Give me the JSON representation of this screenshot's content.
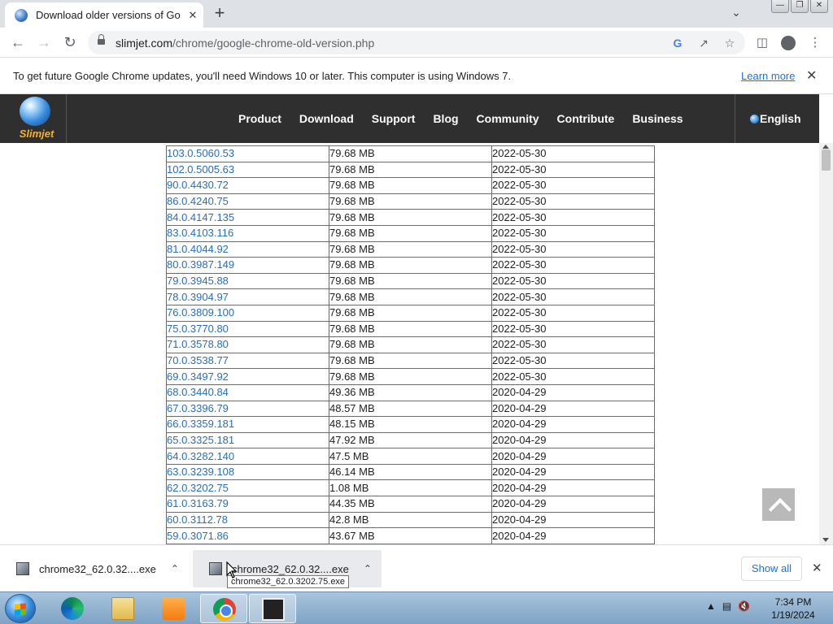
{
  "browser": {
    "tab_title": "Download older versions of Goog",
    "tab_close": "✕",
    "new_tab": "+",
    "tab_search": "⌄",
    "window_buttons": [
      "—",
      "❐",
      "✕"
    ],
    "url_domain": "slimjet.com",
    "url_path": "/chrome/google-chrome-old-version.php"
  },
  "infobar": {
    "message": "To get future Google Chrome updates, you'll need Windows 10 or later. This computer is using Windows 7.",
    "learn_more": "Learn more",
    "close": "✕"
  },
  "site": {
    "logo_text": "Slimjet",
    "nav": [
      "Product",
      "Download",
      "Support",
      "Blog",
      "Community",
      "Contribute",
      "Business"
    ],
    "language": "English"
  },
  "versions": [
    {
      "version": "103.0.5060.53",
      "size": "79.68 MB",
      "date": "2022-05-30"
    },
    {
      "version": "102.0.5005.63",
      "size": "79.68 MB",
      "date": "2022-05-30"
    },
    {
      "version": "90.0.4430.72",
      "size": "79.68 MB",
      "date": "2022-05-30"
    },
    {
      "version": "86.0.4240.75",
      "size": "79.68 MB",
      "date": "2022-05-30"
    },
    {
      "version": "84.0.4147.135",
      "size": "79.68 MB",
      "date": "2022-05-30"
    },
    {
      "version": "83.0.4103.116",
      "size": "79.68 MB",
      "date": "2022-05-30"
    },
    {
      "version": "81.0.4044.92",
      "size": "79.68 MB",
      "date": "2022-05-30"
    },
    {
      "version": "80.0.3987.149",
      "size": "79.68 MB",
      "date": "2022-05-30"
    },
    {
      "version": "79.0.3945.88",
      "size": "79.68 MB",
      "date": "2022-05-30"
    },
    {
      "version": "78.0.3904.97",
      "size": "79.68 MB",
      "date": "2022-05-30"
    },
    {
      "version": "76.0.3809.100",
      "size": "79.68 MB",
      "date": "2022-05-30"
    },
    {
      "version": "75.0.3770.80",
      "size": "79.68 MB",
      "date": "2022-05-30"
    },
    {
      "version": "71.0.3578.80",
      "size": "79.68 MB",
      "date": "2022-05-30"
    },
    {
      "version": "70.0.3538.77",
      "size": "79.68 MB",
      "date": "2022-05-30"
    },
    {
      "version": "69.0.3497.92",
      "size": "79.68 MB",
      "date": "2022-05-30"
    },
    {
      "version": "68.0.3440.84",
      "size": "49.36 MB",
      "date": "2020-04-29"
    },
    {
      "version": "67.0.3396.79",
      "size": "48.57 MB",
      "date": "2020-04-29"
    },
    {
      "version": "66.0.3359.181",
      "size": "48.15 MB",
      "date": "2020-04-29"
    },
    {
      "version": "65.0.3325.181",
      "size": "47.92 MB",
      "date": "2020-04-29"
    },
    {
      "version": "64.0.3282.140",
      "size": "47.5 MB",
      "date": "2020-04-29"
    },
    {
      "version": "63.0.3239.108",
      "size": "46.14 MB",
      "date": "2020-04-29"
    },
    {
      "version": "62.0.3202.75",
      "size": "1.08 MB",
      "date": "2020-04-29"
    },
    {
      "version": "61.0.3163.79",
      "size": "44.35 MB",
      "date": "2020-04-29"
    },
    {
      "version": "60.0.3112.78",
      "size": "42.8 MB",
      "date": "2020-04-29"
    },
    {
      "version": "59.0.3071.86",
      "size": "43.67 MB",
      "date": "2020-04-29"
    }
  ],
  "downloads": {
    "items": [
      {
        "name": "chrome32_62.0.32....exe"
      },
      {
        "name": "chrome32_62.0.32....exe"
      }
    ],
    "tooltip": "chrome32_62.0.3202.75.exe",
    "show_all": "Show all",
    "close": "✕"
  },
  "taskbar": {
    "time": "7:34 PM",
    "date": "1/19/2024"
  }
}
